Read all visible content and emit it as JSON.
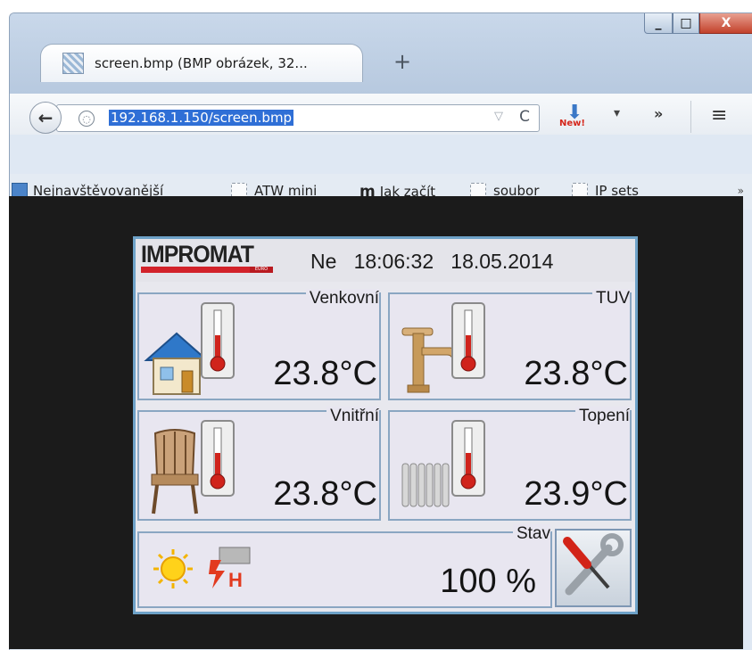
{
  "window": {
    "tab_title": "screen.bmp (BMP obrázek, 32...",
    "new_tab": "+",
    "min_label": "_",
    "max_label": "□",
    "close_label": "X"
  },
  "navbar": {
    "back": "🡐",
    "url": "192.168.1.150/screen.bmp",
    "reload": "C",
    "dropdown": "▽",
    "download_badge": "New!",
    "more": "»",
    "menu": "≡",
    "nav_dropdown": "▾"
  },
  "bookmarks": {
    "items": [
      {
        "label": "Nejnavštěvovanější"
      },
      {
        "label": "ATW mini"
      },
      {
        "label": "Jak začít"
      },
      {
        "label": "soubor"
      },
      {
        "label": "IP sets"
      }
    ],
    "more": "»"
  },
  "device": {
    "brand": "IMPROMAT",
    "brand_sub": "EURO",
    "day": "Ne",
    "time": "18:06:32",
    "date": "18.05.2014",
    "panels": [
      {
        "title": "Venkovní",
        "temp": "23.8°C"
      },
      {
        "title": "TUV",
        "temp": "23.8°C"
      },
      {
        "title": "Vnitřní",
        "temp": "23.8°C"
      },
      {
        "title": "Topení",
        "temp": "23.9°C"
      }
    ],
    "status": {
      "title": "Stav",
      "value": "100 %"
    }
  }
}
